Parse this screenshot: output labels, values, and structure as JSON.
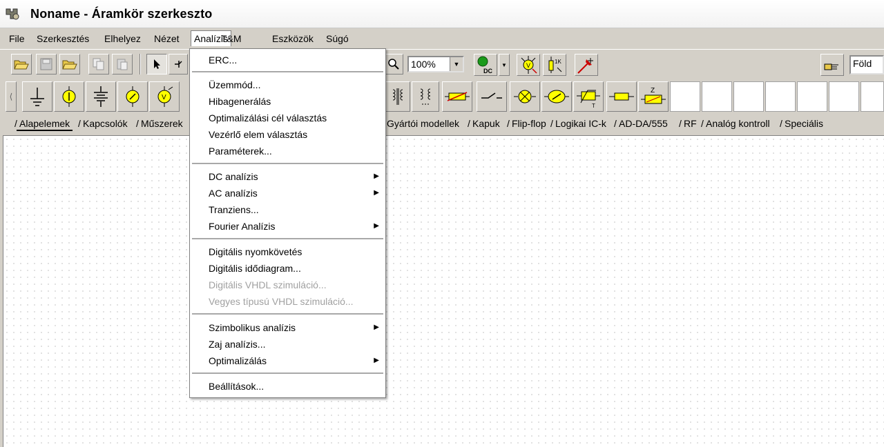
{
  "window": {
    "title": "Noname - Áramkör szerkeszto"
  },
  "menubar": [
    "File",
    "Szerkesztés",
    "Elhelyez",
    "Nézet",
    "Analízis",
    "T&M",
    "Eszközök",
    "Súgó"
  ],
  "toolbar": {
    "zoom": "100%",
    "layer_value": "Föld"
  },
  "component_tabs": [
    "Alapelemek",
    "Kapcsolók",
    "Műszerek",
    "Gyártói modellek",
    "Kapuk",
    "Flip-flop",
    "Logikai IC-k",
    "AD-DA/555",
    "RF",
    "Analóg kontroll",
    "Speciális"
  ],
  "analysis_menu": {
    "items": [
      {
        "label": "ERC...",
        "enabled": true,
        "submenu": false
      },
      {
        "label": "Üzemmód...",
        "enabled": true,
        "submenu": false
      },
      {
        "label": "Hibagenerálás",
        "enabled": true,
        "submenu": false
      },
      {
        "label": "Optimalizálási cél választás",
        "enabled": true,
        "submenu": false
      },
      {
        "label": "Vezérlő elem választás",
        "enabled": true,
        "submenu": false
      },
      {
        "label": "Paraméterek...",
        "enabled": true,
        "submenu": false
      },
      {
        "label": "DC analízis",
        "enabled": true,
        "submenu": true
      },
      {
        "label": "AC analízis",
        "enabled": true,
        "submenu": true
      },
      {
        "label": "Tranziens...",
        "enabled": true,
        "submenu": false
      },
      {
        "label": "Fourier Analízis",
        "enabled": true,
        "submenu": true
      },
      {
        "label": "Digitális nyomkövetés",
        "enabled": true,
        "submenu": false
      },
      {
        "label": "Digitális idődiagram...",
        "enabled": true,
        "submenu": false
      },
      {
        "label": "Digitális VHDL szimuláció...",
        "enabled": false,
        "submenu": false
      },
      {
        "label": "Vegyes típusú VHDL szimuláció...",
        "enabled": false,
        "submenu": false
      },
      {
        "label": "Szimbolikus analízis",
        "enabled": true,
        "submenu": true
      },
      {
        "label": "Zaj analízis...",
        "enabled": true,
        "submenu": false
      },
      {
        "label": "Optimalizálás",
        "enabled": true,
        "submenu": true
      },
      {
        "label": "Beállítások...",
        "enabled": true,
        "submenu": false
      }
    ],
    "submenu_arrow": "▶"
  },
  "colors": {
    "toolbar_face": "#d4d0c8",
    "component_yellow": "#ffff00",
    "menu_bg": "#ffffff",
    "disabled_text": "#a0a0a0"
  }
}
